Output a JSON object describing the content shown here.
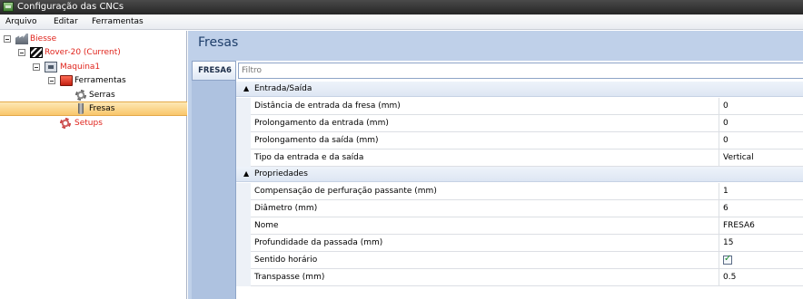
{
  "window": {
    "title": "Configuração das CNCs"
  },
  "menu": [
    "Arquivo",
    "Editar",
    "Ferramentas"
  ],
  "tree": {
    "biesse": "Biesse",
    "rover": "Rover-20 (Current)",
    "maquina": "Maquina1",
    "ferramentas": "Ferramentas",
    "serras": "Serras",
    "fresas": "Fresas",
    "setups": "Setups"
  },
  "content": {
    "title": "Fresas",
    "tab": "FRESA6",
    "filter_placeholder": "Filtro",
    "categories": [
      {
        "label": "Entrada/Saída",
        "rows": [
          {
            "name": "Distância de entrada da fresa (mm)",
            "value": "0"
          },
          {
            "name": "Prolongamento da entrada (mm)",
            "value": "0"
          },
          {
            "name": "Prolongamento da saída (mm)",
            "value": "0"
          },
          {
            "name": "Tipo da entrada e da saída",
            "value": "Vertical"
          }
        ]
      },
      {
        "label": "Propriedades",
        "rows": [
          {
            "name": "Compensação de perfuração passante (mm)",
            "value": "1"
          },
          {
            "name": "Diâmetro (mm)",
            "value": "6"
          },
          {
            "name": "Nome",
            "value": "FRESA6"
          },
          {
            "name": "Profundidade da passada (mm)",
            "value": "15"
          },
          {
            "name": "Sentido horário",
            "checked": true
          },
          {
            "name": "Transpasse (mm)",
            "value": "0.5"
          }
        ]
      }
    ]
  }
}
